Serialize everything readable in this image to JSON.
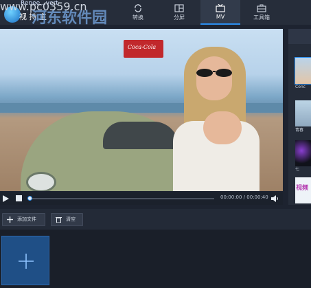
{
  "brand": {
    "app_title": "Renee...vert",
    "watermark_main": "河东软件园",
    "watermark_url": "www.pc0359.cn",
    "fragment": "视 持 主"
  },
  "tabs": [
    {
      "label": "转换",
      "icon": "refresh-icon"
    },
    {
      "label": "分屏",
      "icon": "split-screen-icon"
    },
    {
      "label": "MV",
      "icon": "tv-icon",
      "active": true
    },
    {
      "label": "工具箱",
      "icon": "toolbox-icon"
    }
  ],
  "video": {
    "box_text": "Coca-Cola"
  },
  "player": {
    "time": "00:00:00 / 00:00:40",
    "progress": 0
  },
  "templates": [
    {
      "label": "Conc",
      "selected": true
    },
    {
      "label": "青春"
    },
    {
      "label": "七"
    },
    {
      "label": "",
      "preview_text": "视频"
    }
  ],
  "actions": {
    "add_file": "添加文件",
    "clear": "清空"
  },
  "colors": {
    "accent": "#2c8ff0",
    "background": "#1d2330",
    "add_tile": "#1f4f86"
  }
}
